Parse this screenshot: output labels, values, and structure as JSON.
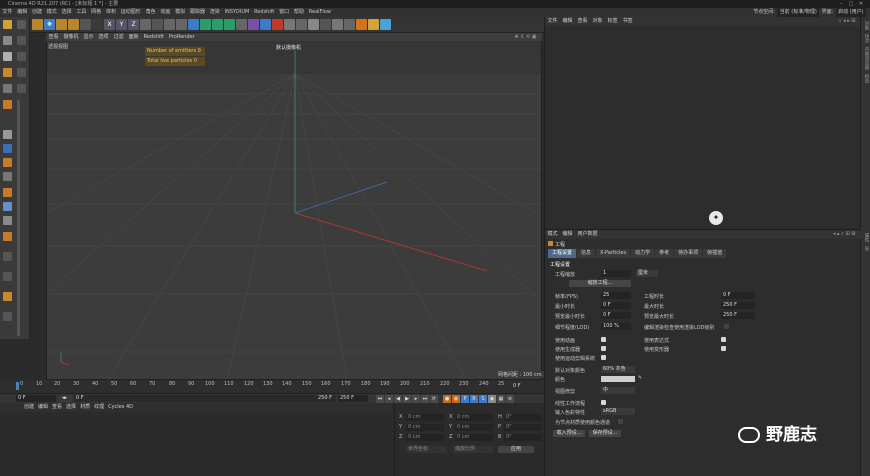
{
  "titlebar": {
    "title": "Cinema 4D R21.207 (RC) - [未标题 1 *] - 主要"
  },
  "menu": [
    "文件",
    "编辑",
    "创建",
    "模式",
    "选择",
    "工具",
    "网格",
    "体积",
    "运动图形",
    "角色",
    "动画",
    "模拟",
    "跟踪器",
    "渲染",
    "INSYDIUM",
    "Redshift",
    "窗口",
    "帮助",
    "RealFlow"
  ],
  "menu_right": {
    "node_space_label": "节点空间:",
    "node_space_value": "当前 (标准/物理)",
    "layout_label": "界面:",
    "layout_value": "启动 (用户)"
  },
  "viewport": {
    "menu": [
      "查看",
      "摄像机",
      "显示",
      "选项",
      "过滤",
      "面板",
      "Redshift",
      "ProRender"
    ],
    "projection": "透视视图",
    "hud_emitters": "Number of emitters 0",
    "hud_particles": "Total live particles 0",
    "camera": "默认摄像机",
    "grid_spacing": "网格间距 : 100 cm"
  },
  "timeline": {
    "ticks": [
      "0",
      "10",
      "20",
      "30",
      "40",
      "50",
      "60",
      "70",
      "80",
      "90",
      "100",
      "110",
      "120",
      "130",
      "140",
      "150",
      "160",
      "170",
      "180",
      "190",
      "200",
      "210",
      "220",
      "230",
      "240",
      "25"
    ],
    "current_frame": "0 F",
    "start": "0 F",
    "preview_start": "0 F",
    "preview_end": "250 F",
    "end": "250 F"
  },
  "material": {
    "menu": [
      "创建",
      "编辑",
      "查看",
      "选择",
      "材质",
      "纹理",
      "Cycles 4D"
    ]
  },
  "coords": {
    "rows": [
      {
        "axis": "X",
        "pos": "0 cm",
        "axis2": "X",
        "size": "0 cm",
        "axis3": "H",
        "rot": "0°"
      },
      {
        "axis": "Y",
        "pos": "0 cm",
        "axis2": "Y",
        "size": "0 cm",
        "axis3": "P",
        "rot": "0°"
      },
      {
        "axis": "Z",
        "pos": "0 cm",
        "axis2": "Z",
        "size": "0 cm",
        "axis3": "B",
        "rot": "0°"
      }
    ],
    "mode_left": "世界坐标",
    "mode_right": "缩放比例",
    "apply": "应用"
  },
  "object_manager": {
    "menu": [
      "文件",
      "编辑",
      "查看",
      "对象",
      "标签",
      "书签"
    ]
  },
  "attributes": {
    "menu": [
      "模式",
      "编辑",
      "用户数据"
    ],
    "title": "工程",
    "tabs": [
      "工程设置",
      "信息",
      "X-Particles",
      "动力学",
      "参考",
      "待办事项",
      "帧插值"
    ],
    "section": "工程设置",
    "scale_label": "工程缩放",
    "scale_value": "1",
    "scale_unit": "厘米",
    "scale_button": "缩放工程...",
    "fps_label": "帧率(FPS)",
    "fps_value": "25",
    "project_time_label": "工程时长",
    "project_time_value": "0 F",
    "min_time_label": "最小时长",
    "min_time_value": "0 F",
    "max_time_label": "最大时长",
    "max_time_value": "250 F",
    "preview_min_label": "预览最小时长",
    "preview_min_value": "0 F",
    "preview_max_label": "预览最大时长",
    "preview_max_value": "250 F",
    "lod_label": "细节程度(LOD)",
    "lod_value": "100 %",
    "lod_render_label": "编辑渲染检查使用渲染LOD级别",
    "use_animation": "使用动画",
    "use_expression": "使用表达式",
    "use_generator": "使用生成器",
    "use_deformer": "使用变形器",
    "use_motion_system": "使用运动剪辑系统",
    "default_color_label": "默认对象颜色",
    "default_color_value": "60% 灰色",
    "color_label": "颜色",
    "view_clipping_label": "视图修剪",
    "view_clipping_value": "中",
    "linear_workflow": "线性工作流程",
    "input_color_label": "输入色彩特性",
    "input_color_value": "sRGB",
    "node_color_label": "为节点材质使用颜色通道",
    "load_preset": "载入预设...",
    "save_preset": "保存预设..."
  },
  "right_strip": [
    "对象",
    "场次",
    "内容浏览器",
    "构造"
  ],
  "right_strip2": [
    "属性",
    "层"
  ],
  "watermark": "野鹿志",
  "colors": {
    "axis_x": "#c0392b",
    "axis_y": "#2e9c6a",
    "axis_z": "#3b6fb6",
    "accent_tab": "#4d6a8a"
  }
}
